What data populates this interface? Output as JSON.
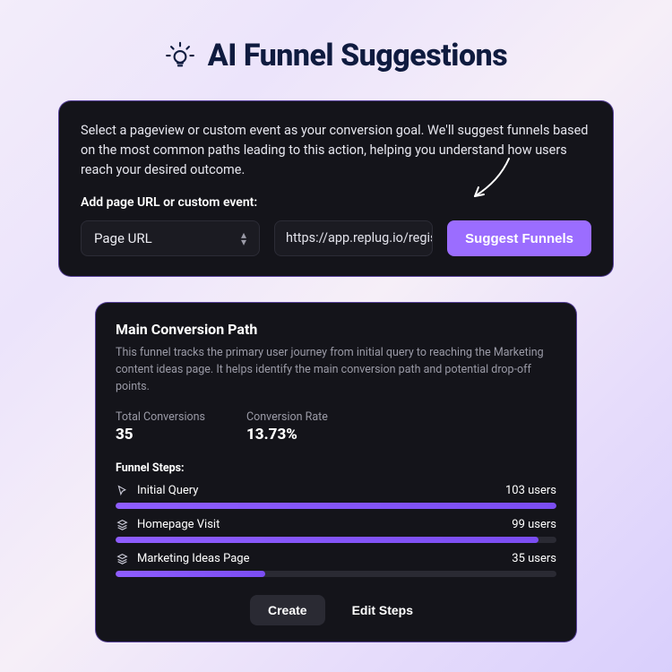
{
  "header": {
    "title": "AI Funnel Suggestions"
  },
  "input_panel": {
    "description": "Select a pageview or custom event as your conversion goal. We'll suggest funnels based on the most common paths leading to this action, helping you understand how users reach your desired outcome.",
    "label": "Add page URL or custom event:",
    "select_value": "Page URL",
    "url_value": "https://app.replug.io/regis",
    "button": "Suggest Funnels"
  },
  "result_panel": {
    "title": "Main Conversion Path",
    "subtitle": "This funnel tracks the primary user journey from initial query to reaching the Marketing content ideas page. It helps identify the main conversion path and potential drop-off points.",
    "metrics": {
      "conversions_label": "Total Conversions",
      "conversions_value": "35",
      "rate_label": "Conversion Rate",
      "rate_value": "13.73%"
    },
    "steps_label": "Funnel Steps:",
    "steps": [
      {
        "name": "Initial Query",
        "count_text": "103 users",
        "fill": 100
      },
      {
        "name": "Homepage Visit",
        "count_text": "99 users",
        "fill": 96
      },
      {
        "name": "Marketing Ideas Page",
        "count_text": "35 users",
        "fill": 34
      }
    ],
    "actions": {
      "create": "Create",
      "edit": "Edit Steps"
    }
  },
  "chart_data": {
    "type": "bar",
    "title": "Main Conversion Path — Funnel Steps",
    "categories": [
      "Initial Query",
      "Homepage Visit",
      "Marketing Ideas Page"
    ],
    "values": [
      103,
      99,
      35
    ],
    "xlabel": "Step",
    "ylabel": "Users",
    "ylim": [
      0,
      103
    ]
  }
}
